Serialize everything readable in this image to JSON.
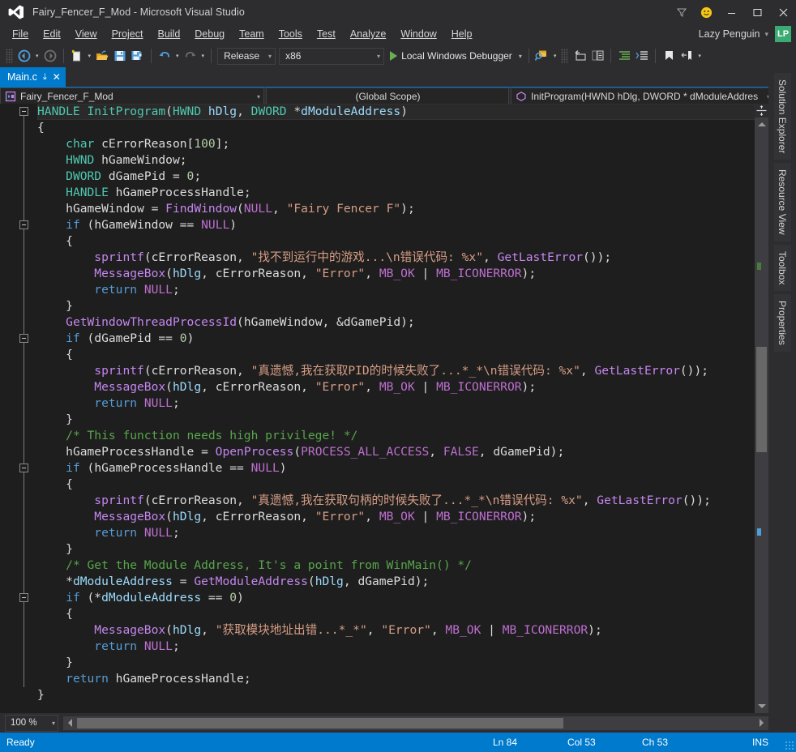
{
  "titlebar": {
    "logo_icon": "visual-studio-logo",
    "title": "Fairy_Fencer_F_Mod - Microsoft Visual Studio",
    "feedback_icon": "funnel-icon",
    "smiley_icon": "smiley-face-icon",
    "minimize_icon": "minimize-icon",
    "maximize_icon": "maximize-icon",
    "close_icon": "close-icon",
    "minimize_glyph": "—",
    "maximize_glyph": "☐",
    "close_glyph": "✕"
  },
  "menubar": {
    "items": [
      {
        "label": "File",
        "accel": "F"
      },
      {
        "label": "Edit",
        "accel": "E"
      },
      {
        "label": "View",
        "accel": "V"
      },
      {
        "label": "Project",
        "accel": "P"
      },
      {
        "label": "Build",
        "accel": "B"
      },
      {
        "label": "Debug",
        "accel": "D"
      },
      {
        "label": "Team",
        "accel": "m"
      },
      {
        "label": "Tools",
        "accel": "T"
      },
      {
        "label": "Test",
        "accel": "s"
      },
      {
        "label": "Analyze",
        "accel": "A"
      },
      {
        "label": "Window",
        "accel": "W"
      },
      {
        "label": "Help",
        "accel": "H"
      }
    ],
    "account_name": "Lazy Penguin",
    "account_caret": "▾",
    "avatar_initials": "LP",
    "avatar_color": "#3aab72"
  },
  "toolbar": {
    "nav_back_icon": "navigate-backward-icon",
    "nav_forward_icon": "navigate-forward-icon",
    "new_file_icon": "new-file-icon",
    "open_file_icon": "open-file-icon",
    "save_icon": "save-icon",
    "save_all_icon": "save-all-icon",
    "undo_icon": "undo-icon",
    "redo_icon": "redo-icon",
    "configuration": "Release",
    "platform": "x86",
    "run_label": "Local Windows Debugger",
    "run_icon": "play-icon",
    "find_icon": "find-in-files-icon",
    "step_icon": "step-into-icon",
    "window_icon": "new-window-icon",
    "indent_icon": "increase-indent-icon",
    "outdent_icon": "decrease-indent-icon",
    "bookmark_icon": "bookmark-icon",
    "toggle_icon": "toggle-bookmark-icon",
    "caret": "▾"
  },
  "tabstrip": {
    "active_tab": "Main.c",
    "pin_icon": "pin-icon",
    "close_icon": "close-tab-icon",
    "pin_glyph": "⤓",
    "close_glyph": "✕",
    "overflow_caret": "▾"
  },
  "navbar": {
    "project": "Fairy_Fencer_F_Mod",
    "project_icon": "cpp-project-icon",
    "scope": "(Global Scope)",
    "function": "InitProgram(HWND hDlg, DWORD * dModuleAddres",
    "function_icon": "method-icon",
    "caret": "▾"
  },
  "editor": {
    "split_icon": "split-view-icon",
    "scroll_up_icon": "scroll-up-arrow-icon",
    "scroll_down_icon": "scroll-down-arrow-icon",
    "scroll_left_icon": "scroll-left-arrow-icon",
    "scroll_right_icon": "scroll-right-arrow-icon",
    "vertical_thumb_icon": "vertical-scrollbar-thumb",
    "horizontal_thumb_icon": "horizontal-scrollbar-thumb",
    "fold_collapse_icon": "collapse-region-icon",
    "language": "C",
    "code_lines": [
      "HANDLE InitProgram(HWND hDlg, DWORD *dModuleAddress)",
      "{",
      "    char cErrorReason[100];",
      "    HWND hGameWindow;",
      "    DWORD dGamePid = 0;",
      "    HANDLE hGameProcessHandle;",
      "    hGameWindow = FindWindow(NULL, \"Fairy Fencer F\");",
      "    if (hGameWindow == NULL)",
      "    {",
      "        sprintf(cErrorReason, \"找不到运行中的游戏...\\n错误代码: %x\", GetLastError());",
      "        MessageBox(hDlg, cErrorReason, \"Error\", MB_OK | MB_ICONERROR);",
      "        return NULL;",
      "    }",
      "    GetWindowThreadProcessId(hGameWindow, &dGamePid);",
      "    if (dGamePid == 0)",
      "    {",
      "        sprintf(cErrorReason, \"真遗憾,我在获取PID的时候失败了...*_*\\n错误代码: %x\", GetLastError());",
      "        MessageBox(hDlg, cErrorReason, \"Error\", MB_OK | MB_ICONERROR);",
      "        return NULL;",
      "    }",
      "    /* This function needs high privilege! */",
      "    hGameProcessHandle = OpenProcess(PROCESS_ALL_ACCESS, FALSE, dGamePid);",
      "    if (hGameProcessHandle == NULL)",
      "    {",
      "        sprintf(cErrorReason, \"真遗憾,我在获取句柄的时候失败了...*_*\\n错误代码: %x\", GetLastError());",
      "        MessageBox(hDlg, cErrorReason, \"Error\", MB_OK | MB_ICONERROR);",
      "        return NULL;",
      "    }",
      "    /* Get the Module Address, It's a point from WinMain() */",
      "    *dModuleAddress = GetModuleAddress(hDlg, dGamePid);",
      "    if (*dModuleAddress == 0)",
      "    {",
      "        MessageBox(hDlg, \"获取模块地址出错...*_*\", \"Error\", MB_OK | MB_ICONERROR);",
      "        return NULL;",
      "    }",
      "    return hGameProcessHandle;",
      "}"
    ]
  },
  "tool_tabs": [
    {
      "label": "Solution Explorer",
      "name": "solution-explorer"
    },
    {
      "label": "Resource View",
      "name": "resource-view"
    },
    {
      "label": "Toolbox",
      "name": "toolbox"
    },
    {
      "label": "Properties",
      "name": "properties"
    }
  ],
  "zoom": {
    "level": "100 %",
    "caret": "▾"
  },
  "statusbar": {
    "state": "Ready",
    "line": "Ln 84",
    "column": "Col 53",
    "character": "Ch 53",
    "insert_mode": "INS",
    "accent_color": "#007acc",
    "resize_grip_icon": "resize-grip-icon"
  }
}
